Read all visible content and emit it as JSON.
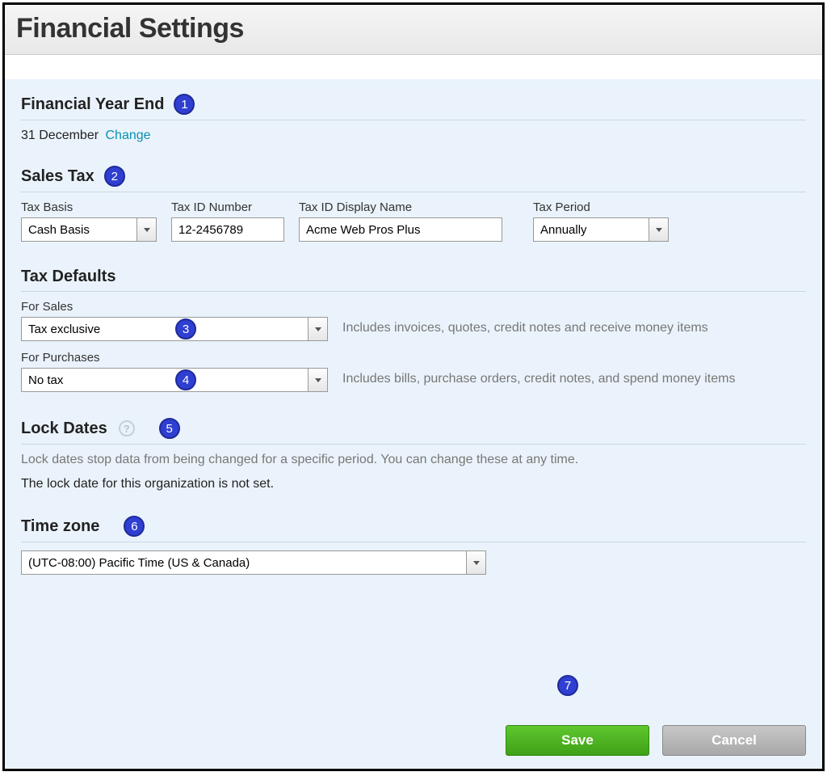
{
  "page_title": "Financial Settings",
  "badges": {
    "b1": "1",
    "b2": "2",
    "b3": "3",
    "b4": "4",
    "b5": "5",
    "b6": "6",
    "b7": "7"
  },
  "fye": {
    "heading": "Financial Year End",
    "date": "31 December",
    "change_label": "Change"
  },
  "sales_tax": {
    "heading": "Sales Tax",
    "tax_basis_label": "Tax Basis",
    "tax_basis_value": "Cash Basis",
    "tax_id_number_label": "Tax ID Number",
    "tax_id_number_value": "12-2456789",
    "tax_id_display_label": "Tax ID Display Name",
    "tax_id_display_value": "Acme Web Pros Plus",
    "tax_period_label": "Tax Period",
    "tax_period_value": "Annually"
  },
  "tax_defaults": {
    "heading": "Tax Defaults",
    "for_sales_label": "For Sales",
    "for_sales_value": "Tax exclusive",
    "for_sales_desc": "Includes invoices, quotes, credit notes and receive money items",
    "for_purchases_label": "For Purchases",
    "for_purchases_value": "No tax",
    "for_purchases_desc": "Includes bills, purchase orders, credit notes, and spend money items"
  },
  "lock_dates": {
    "heading": "Lock Dates",
    "help": "?",
    "desc": "Lock dates stop data from being changed for a specific period. You can change these at any time.",
    "status": "The lock date for this organization is not set."
  },
  "time_zone": {
    "heading": "Time zone",
    "value": "(UTC-08:00) Pacific Time (US & Canada)"
  },
  "buttons": {
    "save": "Save",
    "cancel": "Cancel"
  }
}
